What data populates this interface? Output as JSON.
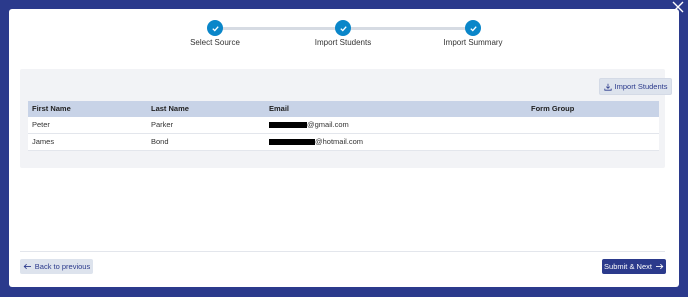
{
  "stepper": {
    "steps": [
      {
        "label": "Select Source",
        "status": "complete"
      },
      {
        "label": "Import Students",
        "status": "complete"
      },
      {
        "label": "Import Summary",
        "status": "complete"
      }
    ]
  },
  "card": {
    "import_button_label": "Import Students",
    "table": {
      "headers": [
        "First Name",
        "Last Name",
        "Email",
        "Form Group"
      ],
      "rows": [
        {
          "first_name": "Peter",
          "last_name": "Parker",
          "email_suffix": "@gmail.com",
          "form_group": ""
        },
        {
          "first_name": "James",
          "last_name": "Bond",
          "email_suffix": "@hotmail.com",
          "form_group": ""
        }
      ]
    }
  },
  "footer": {
    "back_label": "Back to previous",
    "next_label": "Submit & Next"
  },
  "colors": {
    "brand": "#2b3a8c",
    "step_complete": "#0a86c9",
    "table_header": "#c8d3e7"
  },
  "icons": {
    "close": "close-icon",
    "step": "check-icon",
    "import": "download-icon",
    "back": "arrow-left-icon",
    "next": "arrow-right-icon"
  }
}
